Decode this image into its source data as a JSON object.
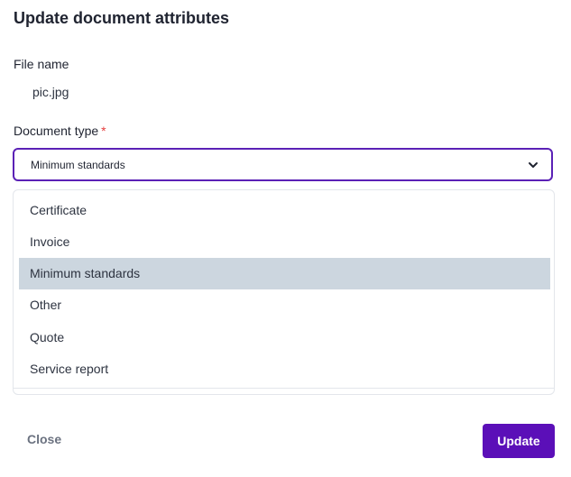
{
  "dialog": {
    "title": "Update document attributes"
  },
  "file": {
    "label": "File name",
    "value": "pic.jpg"
  },
  "document_type": {
    "label": "Document type",
    "required_marker": "*",
    "selected": "Minimum standards",
    "options": [
      "Certificate",
      "Invoice",
      "Minimum standards",
      "Other",
      "Quote",
      "Service report"
    ],
    "selected_index": 2
  },
  "actions": {
    "close_label": "Close",
    "update_label": "Update"
  },
  "colors": {
    "accent": "#5b0fb8",
    "select_border": "#5b21b6",
    "selected_option_bg": "#ccd6df",
    "required": "#e53e3e"
  }
}
